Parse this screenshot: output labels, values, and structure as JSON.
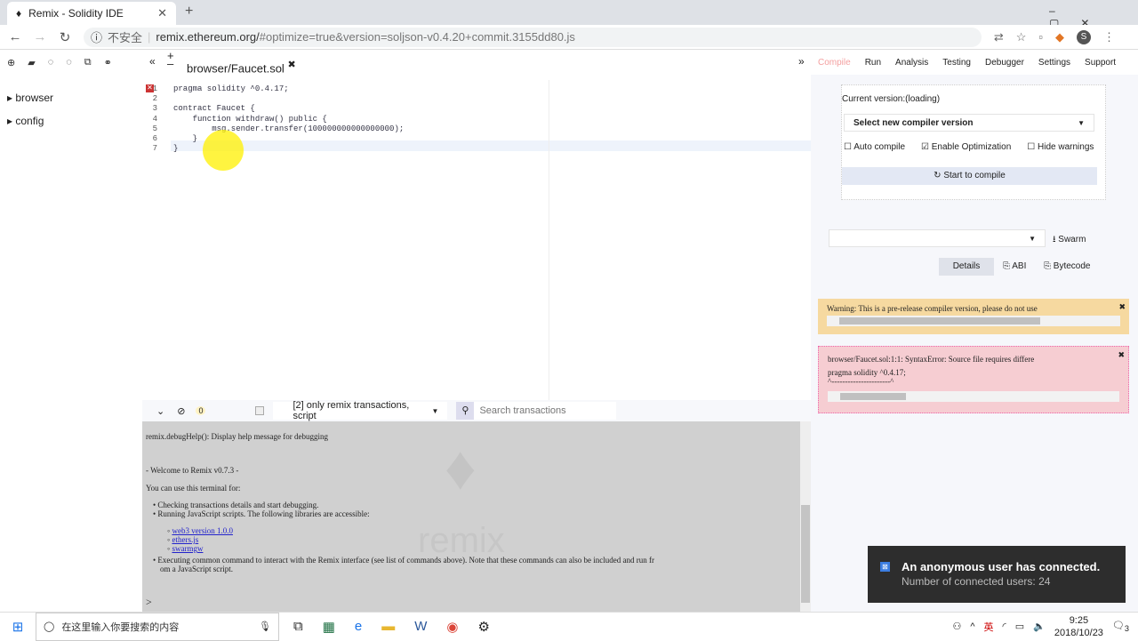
{
  "browser": {
    "tab_title": "Remix - Solidity IDE",
    "url_warning": "不安全",
    "url_host": "remix.ethereum.org/",
    "url_rest": "#optimize=true&version=soljson-v0.4.20+commit.3155dd80.js",
    "profile": "S"
  },
  "files": {
    "items": [
      {
        "label": "browser"
      },
      {
        "label": "config"
      }
    ]
  },
  "editor": {
    "tab": "browser/Faucet.sol",
    "lines": [
      {
        "n": "1",
        "t": "pragma solidity ^0.4.17;"
      },
      {
        "n": "2",
        "t": ""
      },
      {
        "n": "3",
        "t": "contract Faucet {"
      },
      {
        "n": "4",
        "t": "    function withdraw() public {"
      },
      {
        "n": "5",
        "t": "        msg.sender.transfer(100000000000000000);"
      },
      {
        "n": "6",
        "t": "    }"
      },
      {
        "n": "7",
        "t": "}"
      }
    ]
  },
  "terminal": {
    "count": "0",
    "filter": "[2] only remix transactions, script",
    "search_placeholder": "Search transactions",
    "lines": {
      "debug": "remix.debugHelp(): Display help message for debugging",
      "welcome": " - Welcome to Remix v0.7.3 -",
      "use": "You can use this terminal for:",
      "b1": "Checking transactions details and start debugging.",
      "b2": "Running JavaScript scripts. The following libraries are accessible:",
      "l1": "web3 version 1.0.0",
      "l2": "ethers.js",
      "l3": "swarmgw",
      "b3": "Executing common command to interact with the Remix interface (see list of commands above). Note that these commands can also be included and run fr",
      "b3b": "om a JavaScript script."
    },
    "prompt": ">"
  },
  "right": {
    "tabs": [
      "Compile",
      "Run",
      "Analysis",
      "Testing",
      "Debugger",
      "Settings",
      "Support"
    ],
    "current_version": "Current version:(loading)",
    "select_version": "Select new compiler version",
    "auto_compile": "Auto compile",
    "enable_opt": "Enable Optimization",
    "hide_warnings": "Hide warnings",
    "compile_btn": "Start to compile",
    "swarm": "Swarm",
    "details": "Details",
    "abi": "ABI",
    "bytecode": "Bytecode",
    "warning": "Warning: This is a pre-release compiler version, please do not use",
    "error1": "browser/Faucet.sol:1:1: SyntaxError: Source file requires differe",
    "error2": "pragma solidity ^0.4.17;",
    "error3": "^----------------------^"
  },
  "toast": {
    "title": "An anonymous user has connected.",
    "sub": "Number of connected users: 24"
  },
  "taskbar": {
    "search": "在这里输入你要搜索的内容",
    "time": "9:25",
    "date": "2018/10/23",
    "ime": "英",
    "notifications": "3"
  },
  "colors": {
    "compile_tab": "#f4a0a0",
    "warning_bg": "#f6d9a0",
    "error_bg": "#f6cdd2",
    "toast_bg": "#2d2d2d"
  }
}
